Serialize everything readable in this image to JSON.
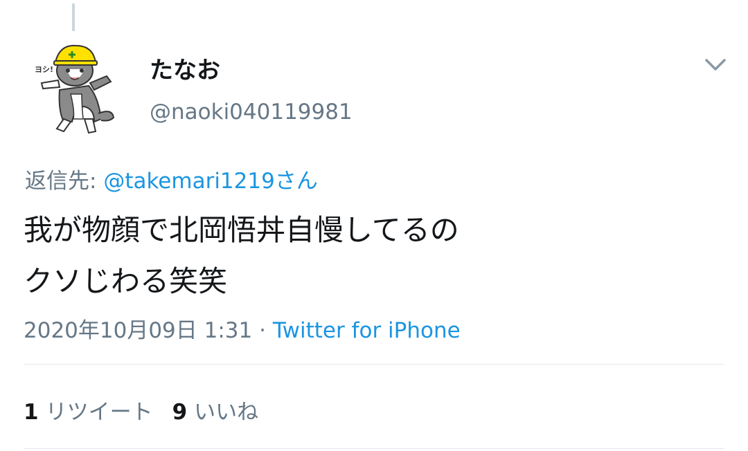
{
  "user": {
    "display_name": "たなお",
    "handle": "@naoki040119981",
    "avatar_text": "ヨシ!"
  },
  "reply": {
    "prefix": "返信先: ",
    "mention": "@takemari1219さん"
  },
  "tweet": {
    "line1": "我が物顔で北岡悟丼自慢してるの",
    "line2": "クソじわる笑笑"
  },
  "meta": {
    "timestamp": "2020年10月09日 1:31",
    "separator": " · ",
    "source": "Twitter for iPhone"
  },
  "stats": {
    "retweets_count": "1",
    "retweets_label": "リツイート",
    "likes_count": "9",
    "likes_label": "いいね"
  },
  "colors": {
    "text": "#14171a",
    "secondary": "#657786",
    "link": "#1b95e0",
    "divider": "#e1e8ed"
  }
}
